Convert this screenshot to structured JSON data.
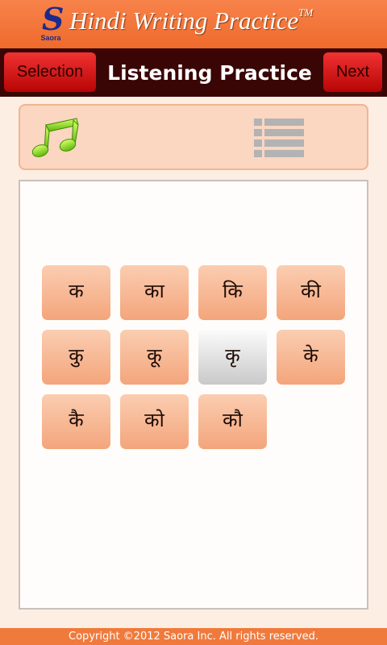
{
  "header": {
    "logo_letter": "S",
    "logo_brand": "Saora",
    "app_title": "Hindi Writing Practice",
    "trademark": "TM"
  },
  "toolbar": {
    "left_button": "Selection",
    "title": "Listening Practice",
    "right_button": "Next"
  },
  "controls": {
    "play_icon": "music-note-icon",
    "list_icon": "list-icon"
  },
  "tiles": [
    "क",
    "का",
    "कि",
    "की",
    "कु",
    "कू",
    "कृ",
    "के",
    "कै",
    "को",
    "कौ"
  ],
  "selected_tile": "कृ",
  "footer": {
    "copyright": "Copyright ©2012 Saora Inc. All rights reserved."
  }
}
